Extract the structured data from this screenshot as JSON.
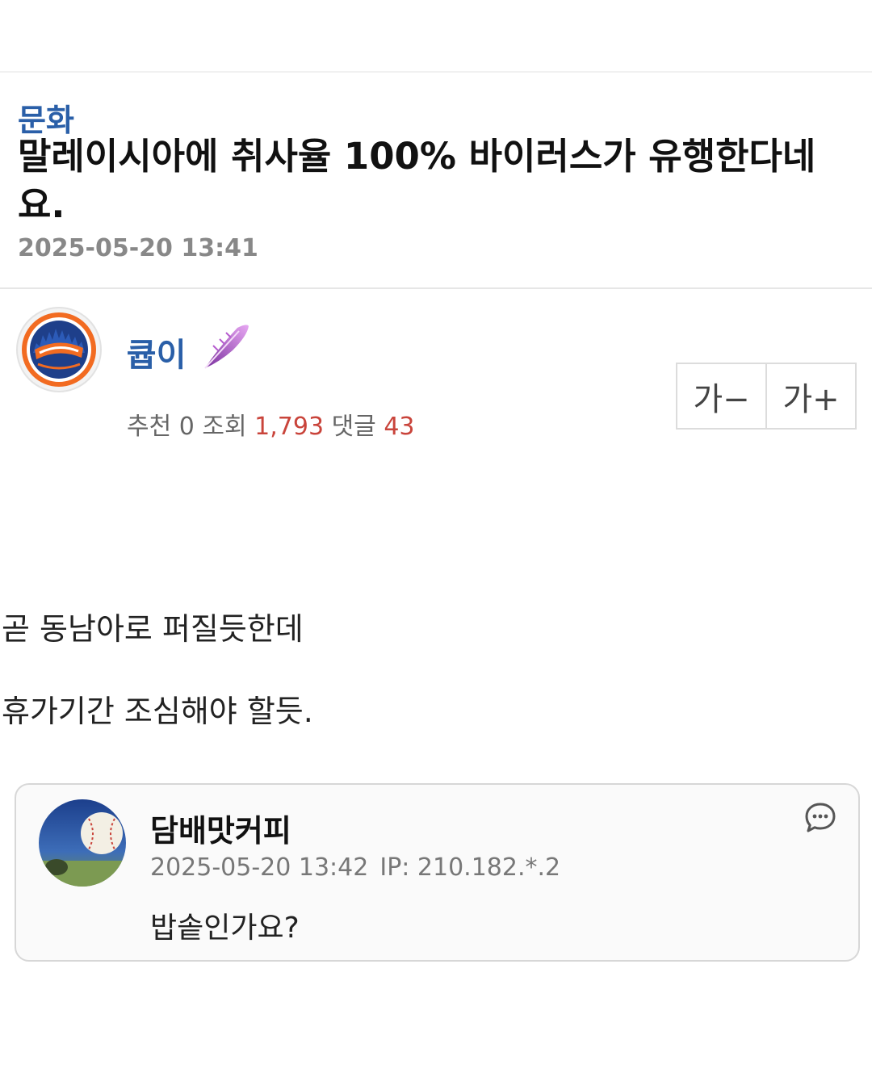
{
  "post": {
    "category": "문화",
    "title": "말레이시아에 취사율 100% 바이러스가 유행한다네요.",
    "date": "2025-05-20 13:41"
  },
  "author": {
    "name": "큡이",
    "avatar_icon": "mets-logo-icon",
    "badge_icon": "purple-feather-badge-icon"
  },
  "stats": {
    "recommend_label": "추천",
    "recommend_count": "0",
    "views_label": "조회",
    "views_count": "1,793",
    "comments_label": "댓글",
    "comments_count": "43"
  },
  "font_controls": {
    "decrease_label": "가−",
    "increase_label": "가+"
  },
  "body": {
    "lines": [
      "곧 동남아로 퍼질듯한데",
      "휴가기간 조심해야 할듯."
    ]
  },
  "comment": {
    "author": "담배맛커피",
    "date": "2025-05-20 13:42",
    "ip": "IP: 210.182.*.2",
    "text": "밥솥인가요?",
    "avatar_icon": "baseball-avatar-icon",
    "reply_icon": "speech-bubble-icon"
  },
  "colors": {
    "accent_blue": "#2a5fa8",
    "count_red": "#c9443b",
    "muted_gray": "#888888"
  }
}
